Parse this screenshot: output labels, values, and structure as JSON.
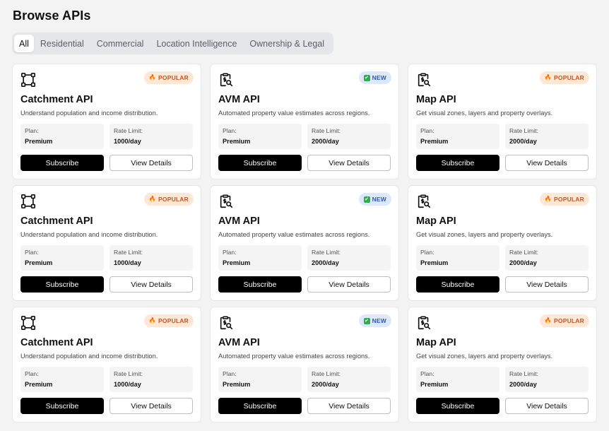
{
  "page": {
    "title": "Browse APIs"
  },
  "tabs": [
    {
      "label": "All",
      "active": true
    },
    {
      "label": "Residential",
      "active": false
    },
    {
      "label": "Commercial",
      "active": false
    },
    {
      "label": "Location Intelligence",
      "active": false
    },
    {
      "label": "Ownership & Legal",
      "active": false
    }
  ],
  "cards": [
    {
      "title": "Catchment API",
      "description": "Understand population and income distribution.",
      "badge": "POPULAR",
      "badge_type": "popular",
      "icon": "bounding-box-icon",
      "plan_label": "Plan:",
      "plan": "Premium",
      "rate_label": "Rate Limit:",
      "rate": "1000/day",
      "subscribe_label": "Subscribe",
      "details_label": "View Details"
    },
    {
      "title": "AVM API",
      "description": "Automated property value estimates across regions.",
      "badge": "NEW",
      "badge_type": "new",
      "icon": "clipboard-dollar-search-icon",
      "plan_label": "Plan:",
      "plan": "Premium",
      "rate_label": "Rate Limit:",
      "rate": "2000/day",
      "subscribe_label": "Subscribe",
      "details_label": "View Details"
    },
    {
      "title": "Map API",
      "description": "Get visual zones, layers and property overlays.",
      "badge": "POPULAR",
      "badge_type": "popular",
      "icon": "clipboard-dollar-search-icon",
      "plan_label": "Plan:",
      "plan": "Premium",
      "rate_label": "Rate Limit:",
      "rate": "2000/day",
      "subscribe_label": "Subscribe",
      "details_label": "View Details"
    },
    {
      "title": "Catchment API",
      "description": "Understand population and income distribution.",
      "badge": "POPULAR",
      "badge_type": "popular",
      "icon": "bounding-box-icon",
      "plan_label": "Plan:",
      "plan": "Premium",
      "rate_label": "Rate Limit:",
      "rate": "1000/day",
      "subscribe_label": "Subscribe",
      "details_label": "View Details"
    },
    {
      "title": "AVM API",
      "description": "Automated property value estimates across regions.",
      "badge": "NEW",
      "badge_type": "new",
      "icon": "clipboard-dollar-search-icon",
      "plan_label": "Plan:",
      "plan": "Premium",
      "rate_label": "Rate Limit:",
      "rate": "2000/day",
      "subscribe_label": "Subscribe",
      "details_label": "View Details"
    },
    {
      "title": "Map API",
      "description": "Get visual zones, layers and property overlays.",
      "badge": "POPULAR",
      "badge_type": "popular",
      "icon": "clipboard-dollar-search-icon",
      "plan_label": "Plan:",
      "plan": "Premium",
      "rate_label": "Rate Limit:",
      "rate": "2000/day",
      "subscribe_label": "Subscribe",
      "details_label": "View Details"
    },
    {
      "title": "Catchment API",
      "description": "Understand population and income distribution.",
      "badge": "POPULAR",
      "badge_type": "popular",
      "icon": "bounding-box-icon",
      "plan_label": "Plan:",
      "plan": "Premium",
      "rate_label": "Rate Limit:",
      "rate": "1000/day",
      "subscribe_label": "Subscribe",
      "details_label": "View Details"
    },
    {
      "title": "AVM API",
      "description": "Automated property value estimates across regions.",
      "badge": "NEW",
      "badge_type": "new",
      "icon": "clipboard-dollar-search-icon",
      "plan_label": "Plan:",
      "plan": "Premium",
      "rate_label": "Rate Limit:",
      "rate": "2000/day",
      "subscribe_label": "Subscribe",
      "details_label": "View Details"
    },
    {
      "title": "Map API",
      "description": "Get visual zones, layers and property overlays.",
      "badge": "POPULAR",
      "badge_type": "popular",
      "icon": "clipboard-dollar-search-icon",
      "plan_label": "Plan:",
      "plan": "Premium",
      "rate_label": "Rate Limit:",
      "rate": "2000/day",
      "subscribe_label": "Subscribe",
      "details_label": "View Details"
    }
  ],
  "colors": {
    "popular_bg": "#fde8d6",
    "popular_text": "#c8551c",
    "new_bg": "#dde8fb",
    "new_text": "#2a58c7",
    "primary_button": "#000000"
  }
}
